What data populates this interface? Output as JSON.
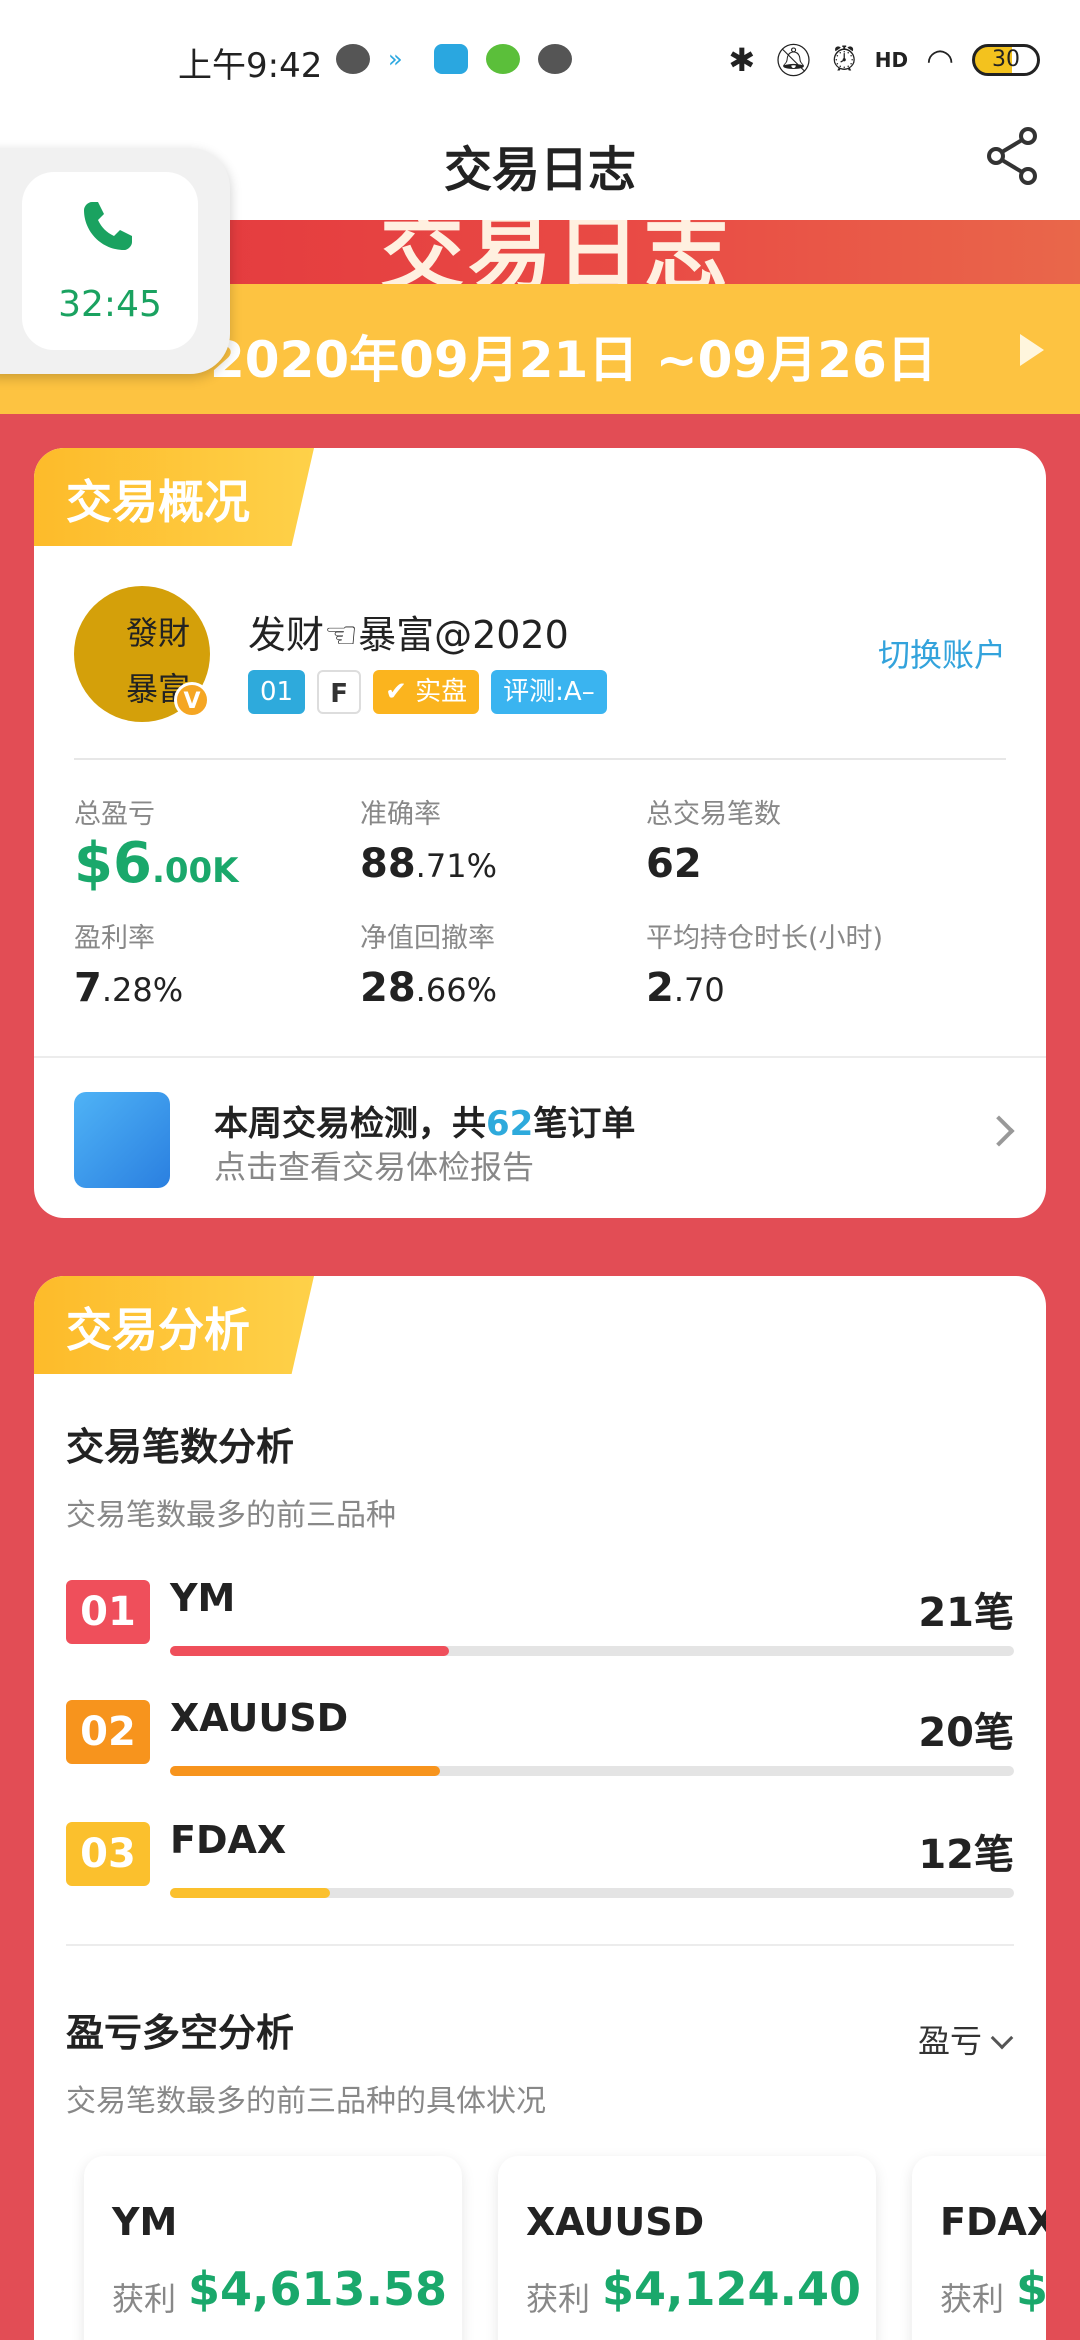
{
  "status_bar": {
    "time": "上午9:42",
    "battery": "30",
    "signal_label": "HD"
  },
  "nav": {
    "title": "交易日志",
    "back_glyph": "‹"
  },
  "call": {
    "duration": "32:45"
  },
  "banner": {
    "art_text": "交易日志",
    "date_range": "2020年09月21日 ~09月26日"
  },
  "overview": {
    "tab_label": "交易概况",
    "avatar_line1": "發財",
    "avatar_line2": "暴富",
    "verified_badge": "V",
    "username": "发财☜暴富@2020",
    "switch_account": "切换账户",
    "tags": {
      "level": "01",
      "broker": "F",
      "real": "实盘",
      "eval": "评测:A–"
    },
    "stats": {
      "total_pnl_label": "总盈亏",
      "total_pnl_main": "$6",
      "total_pnl_unit": ".00K",
      "accuracy_label": "准确率",
      "accuracy_main": "88",
      "accuracy_unit": ".71%",
      "total_trades_label": "总交易笔数",
      "total_trades": "62",
      "profit_rate_label": "盈利率",
      "profit_rate_main": "7",
      "profit_rate_unit": ".28%",
      "drawdown_label": "净值回撤率",
      "drawdown_main": "28",
      "drawdown_unit": ".66%",
      "avg_hold_label": "平均持仓时长(小时)",
      "avg_hold_main": "2",
      "avg_hold_unit": ".70"
    },
    "check": {
      "title_prefix": "本周交易检测，共",
      "count": "62",
      "title_suffix": "笔订单",
      "subtitle": "点击查看交易体检报告"
    }
  },
  "analysis": {
    "tab_label": "交易分析",
    "count_title": "交易笔数分析",
    "count_sub": "交易笔数最多的前三品种",
    "ranks": [
      {
        "rank": "01",
        "name": "YM",
        "count": "21笔",
        "fill": 0.33,
        "color": "#ef4f5b"
      },
      {
        "rank": "02",
        "name": "XAUUSD",
        "count": "20笔",
        "fill": 0.32,
        "color": "#f7941d"
      },
      {
        "rank": "03",
        "name": "FDAX",
        "count": "12笔",
        "fill": 0.19,
        "color": "#fbc02d"
      }
    ],
    "pl_title": "盈亏多空分析",
    "pl_sub": "交易笔数最多的前三品种的具体状况",
    "pl_dropdown": "盈亏",
    "pl_cards": [
      {
        "name": "YM",
        "label": "获利",
        "value": "$4,613.58"
      },
      {
        "name": "XAUUSD",
        "label": "获利",
        "value": "$4,124.40"
      },
      {
        "name": "FDAX",
        "label": "获利",
        "value": "$"
      }
    ]
  }
}
